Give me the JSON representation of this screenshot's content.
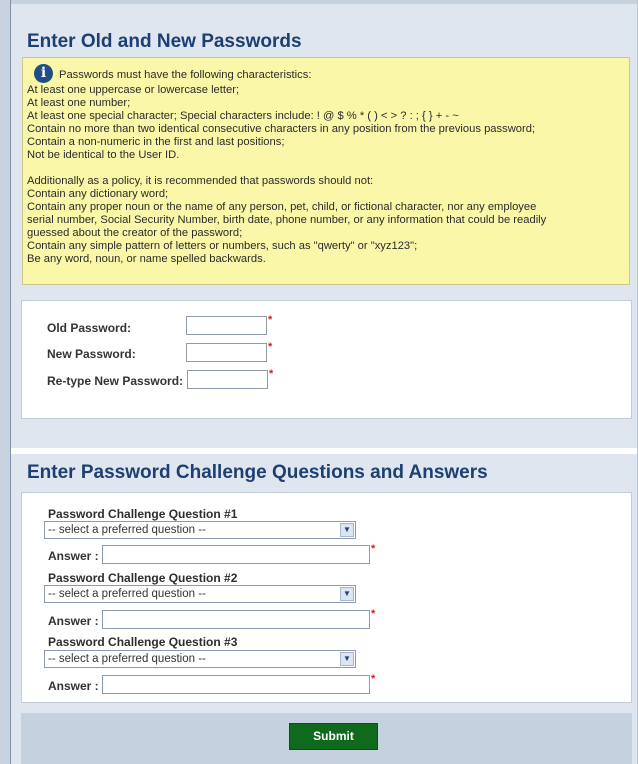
{
  "passwords_section": {
    "title": "Enter Old and New Passwords",
    "notice_lines": [
      "Passwords must have the following characteristics:",
      "At least one uppercase or lowercase letter;",
      "At least one number;",
      "At least one special character; Special characters include: ! @ $ % * ( ) < > ? : ; { } + - ~",
      "Contain no more than two identical consecutive characters in any position from the previous password;",
      "Contain a non-numeric in the first and last positions;",
      "Not be identical to the User ID.",
      "Additionally as a policy, it is recommended that passwords should not:",
      "Contain any dictionary word;",
      "Contain any proper noun or the name of any person, pet, child, or fictional character, nor any employee",
      "serial number, Social Security Number, birth date, phone number, or any information that could be readily",
      "guessed about the creator of the password;",
      "Contain any simple pattern of letters or numbers, such as \"qwerty\" or \"xyz123\";",
      "Be any word, noun, or name spelled backwards."
    ],
    "fields": [
      {
        "label": "Old Password:",
        "value": ""
      },
      {
        "label": "New Password:",
        "value": ""
      },
      {
        "label": "Re-type New Password:",
        "value": ""
      }
    ],
    "required_mark": "*"
  },
  "challenge_section": {
    "title": "Enter Password Challenge Questions and Answers",
    "questions": [
      {
        "label": "Password Challenge Question #1",
        "selected": "-- select a preferred question --",
        "answer_label": "Answer :",
        "answer_value": ""
      },
      {
        "label": "Password Challenge Question #2",
        "selected": "-- select a preferred question --",
        "answer_label": "Answer :",
        "answer_value": ""
      },
      {
        "label": "Password Challenge Question #3",
        "selected": "-- select a preferred question --",
        "answer_label": "Answer :",
        "answer_value": ""
      }
    ]
  },
  "icons": {
    "info": "i",
    "dropdown_arrow": "▼"
  },
  "submit_label": "Submit",
  "colors": {
    "title": "#1d3f72",
    "notice_bg": "#fbf7a8",
    "required": "#d81b1b",
    "submit_bg": "#0f6a1e"
  }
}
